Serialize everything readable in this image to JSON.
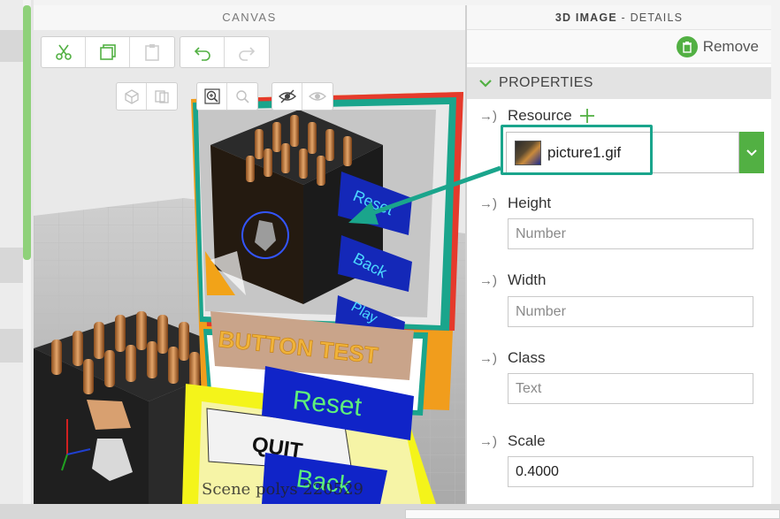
{
  "canvas": {
    "title": "CANVAS",
    "scene_stats": "Scene polys 220529"
  },
  "toolbar_top": {
    "items": [
      {
        "icon": "scissors-icon"
      },
      {
        "icon": "copy-icon"
      },
      {
        "icon": "paste-icon",
        "disabled": true
      },
      {
        "icon": "undo-icon"
      },
      {
        "icon": "redo-icon",
        "disabled": true
      }
    ]
  },
  "toolbar_view": {
    "items": [
      {
        "icon": "cube-icon"
      },
      {
        "icon": "split-view-icon"
      },
      {
        "icon": "zoom-in-icon"
      },
      {
        "icon": "zoom-fit-icon"
      },
      {
        "icon": "hide-icon"
      },
      {
        "icon": "show-icon"
      }
    ]
  },
  "scene_labels": {
    "reset_small": "Reset",
    "back_small": "Back",
    "play_small": "Play",
    "button_test": "BUTTON TEST",
    "reset_big": "Reset",
    "quit": "QUIT",
    "back_big": "Back"
  },
  "details_panel": {
    "header_bold": "3D IMAGE",
    "header_rest": " - DETAILS",
    "remove_label": "Remove",
    "properties_label": "PROPERTIES",
    "resource": {
      "label": "Resource",
      "value": "picture1.gif"
    },
    "height": {
      "label": "Height",
      "placeholder": "Number"
    },
    "width": {
      "label": "Width",
      "placeholder": "Number"
    },
    "class": {
      "label": "Class",
      "placeholder": "Text"
    },
    "scale": {
      "label": "Scale",
      "value": "0.4000"
    }
  },
  "colors": {
    "accent_green": "#52b043",
    "callout_teal": "#1aa58c"
  }
}
